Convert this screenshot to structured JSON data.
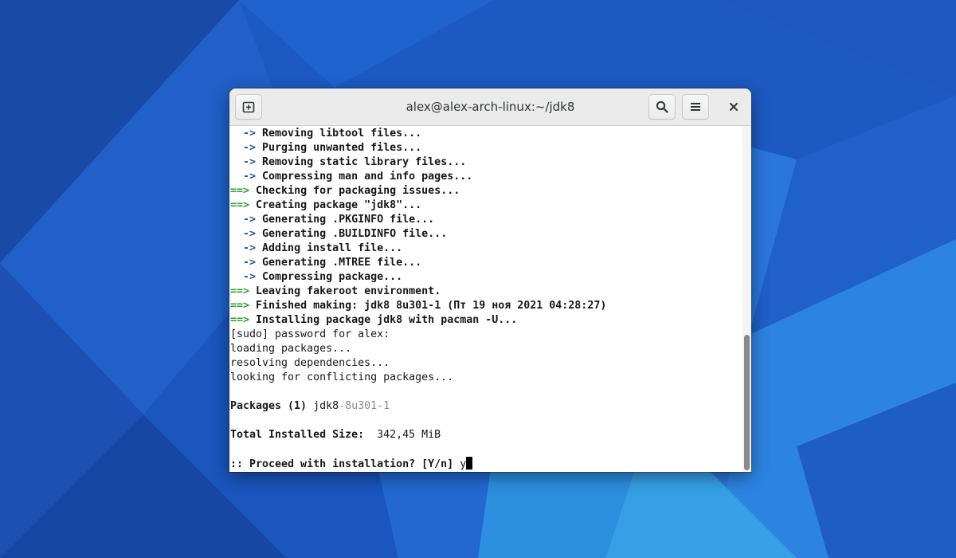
{
  "window": {
    "title": "alex@alex-arch-linux:~/jdk8"
  },
  "icons": {
    "new_tab": "new-tab-icon",
    "search": "search-icon",
    "menu": "menu-icon",
    "close": "close-icon"
  },
  "colors": {
    "desktop_blue": "#1c5ac2",
    "arrow_blue": "#1e5a8e",
    "arrow_green": "#2aa02a",
    "terminal_bg": "#ffffff"
  },
  "terminal": {
    "lines": [
      {
        "prefix": "  ->",
        "text": " Removing libtool files..."
      },
      {
        "prefix": "  ->",
        "text": " Purging unwanted files..."
      },
      {
        "prefix": "  ->",
        "text": " Removing static library files..."
      },
      {
        "prefix": "  ->",
        "text": " Compressing man and info pages..."
      },
      {
        "prefix": "==>",
        "text": " Checking for packaging issues..."
      },
      {
        "prefix": "==>",
        "text": " Creating package \"jdk8\"..."
      },
      {
        "prefix": "  ->",
        "text": " Generating .PKGINFO file..."
      },
      {
        "prefix": "  ->",
        "text": " Generating .BUILDINFO file..."
      },
      {
        "prefix": "  ->",
        "text": " Adding install file..."
      },
      {
        "prefix": "  ->",
        "text": " Generating .MTREE file..."
      },
      {
        "prefix": "  ->",
        "text": " Compressing package..."
      },
      {
        "prefix": "==>",
        "text": " Leaving fakeroot environment."
      },
      {
        "prefix": "==>",
        "text": " Finished making: jdk8 8u301-1 (Пт 19 ноя 2021 04:28:27)"
      },
      {
        "prefix": "==>",
        "text": " Installing package jdk8 with pacman -U..."
      },
      {
        "text": "[sudo] password for alex:"
      },
      {
        "text": "loading packages..."
      },
      {
        "text": "resolving dependencies..."
      },
      {
        "text": "looking for conflicting packages..."
      },
      {
        "text": ""
      },
      {
        "label": "Packages (1)",
        "name": " jdk8",
        "version": "-8u301-1"
      },
      {
        "text": ""
      },
      {
        "label": "Total Installed Size:",
        "value": "  342,45 MiB"
      },
      {
        "text": ""
      },
      {
        "prompt": ":: Proceed with installation? [Y/n]",
        "input": " y"
      }
    ]
  }
}
